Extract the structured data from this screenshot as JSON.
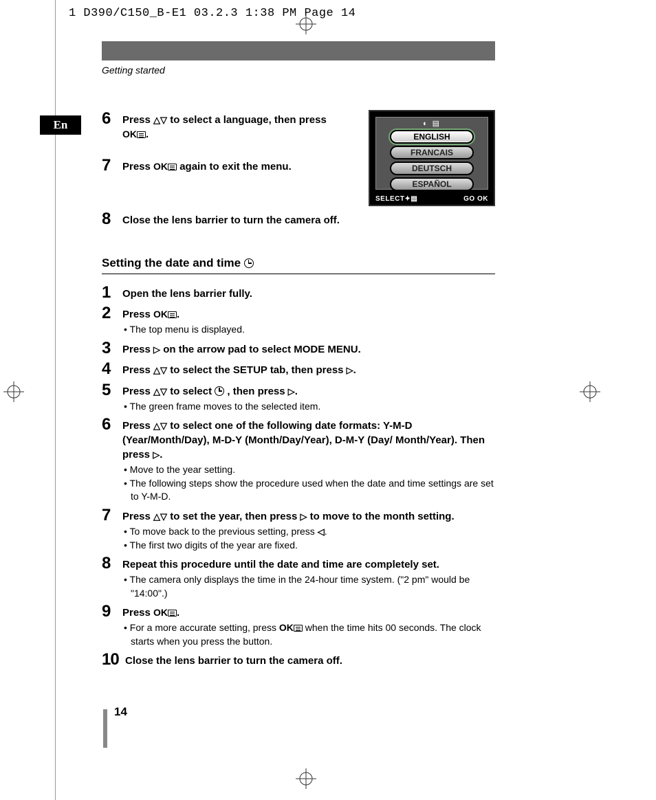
{
  "print_header": "1 D390/C150_B-E1  03.2.3 1:38 PM  Page 14",
  "section_label": "Getting started",
  "lang_tab": "En",
  "lcd": {
    "items": [
      "ENGLISH",
      "FRANCAIS",
      "DEUTSCH",
      "ESPAÑOL"
    ],
    "footer_left": "SELECT",
    "footer_right": "GO  OK"
  },
  "top_steps": {
    "s6": {
      "num": "6",
      "text_a": "Press ",
      "text_b": " to select a language, then press ",
      "text_c": "."
    },
    "s7": {
      "num": "7",
      "text_a": "Press ",
      "text_b": " again to exit the menu."
    },
    "s8": {
      "num": "8",
      "text": "Close the lens barrier to turn the camera off."
    }
  },
  "section_title": "Setting the date and time",
  "steps": {
    "s1": {
      "num": "1",
      "text": "Open the lens barrier fully."
    },
    "s2": {
      "num": "2",
      "text_a": "Press ",
      "text_b": ".",
      "bullets": [
        "The top menu is displayed."
      ]
    },
    "s3": {
      "num": "3",
      "text_a": "Press ",
      "text_b": " on the arrow pad to select MODE MENU."
    },
    "s4": {
      "num": "4",
      "text_a": "Press ",
      "text_b": " to select the SETUP tab, then press ",
      "text_c": "."
    },
    "s5": {
      "num": "5",
      "text_a": "Press ",
      "text_b": " to select ",
      "text_c": " , then press ",
      "text_d": ".",
      "bullets": [
        "The green frame moves to the selected item."
      ]
    },
    "s6": {
      "num": "6",
      "text_a": "Press ",
      "text_b": " to select one of the following date formats: Y-M-D (Year/Month/Day), M-D-Y (Month/Day/Year), D-M-Y (Day/ Month/Year). Then press ",
      "text_c": ".",
      "bullets": [
        "Move to the year setting.",
        "The following steps show the procedure used when the date and time settings are set to Y-M-D."
      ]
    },
    "s7": {
      "num": "7",
      "text_a": "Press ",
      "text_b": " to set the year, then press ",
      "text_c": " to move to the month setting.",
      "bullets_a": "To move back to the previous setting, press ",
      "bullets_a_end": ".",
      "bullets_b": "The first two digits of the year are fixed."
    },
    "s8": {
      "num": "8",
      "text": "Repeat this procedure until the date and time are completely set.",
      "bullets": [
        "The camera only displays the time in the 24-hour time system. (\"2 pm\" would be \"14:00\".)"
      ]
    },
    "s9": {
      "num": "9",
      "text_a": "Press ",
      "text_b": ".",
      "bullets_a": "For a more accurate setting, press ",
      "bullets_b": " when the time hits 00 seconds. The clock starts when you press the button."
    },
    "s10": {
      "num": "10",
      "text": "Close the lens barrier to turn the camera off."
    }
  },
  "page_number": "14",
  "ok_label": "OK"
}
